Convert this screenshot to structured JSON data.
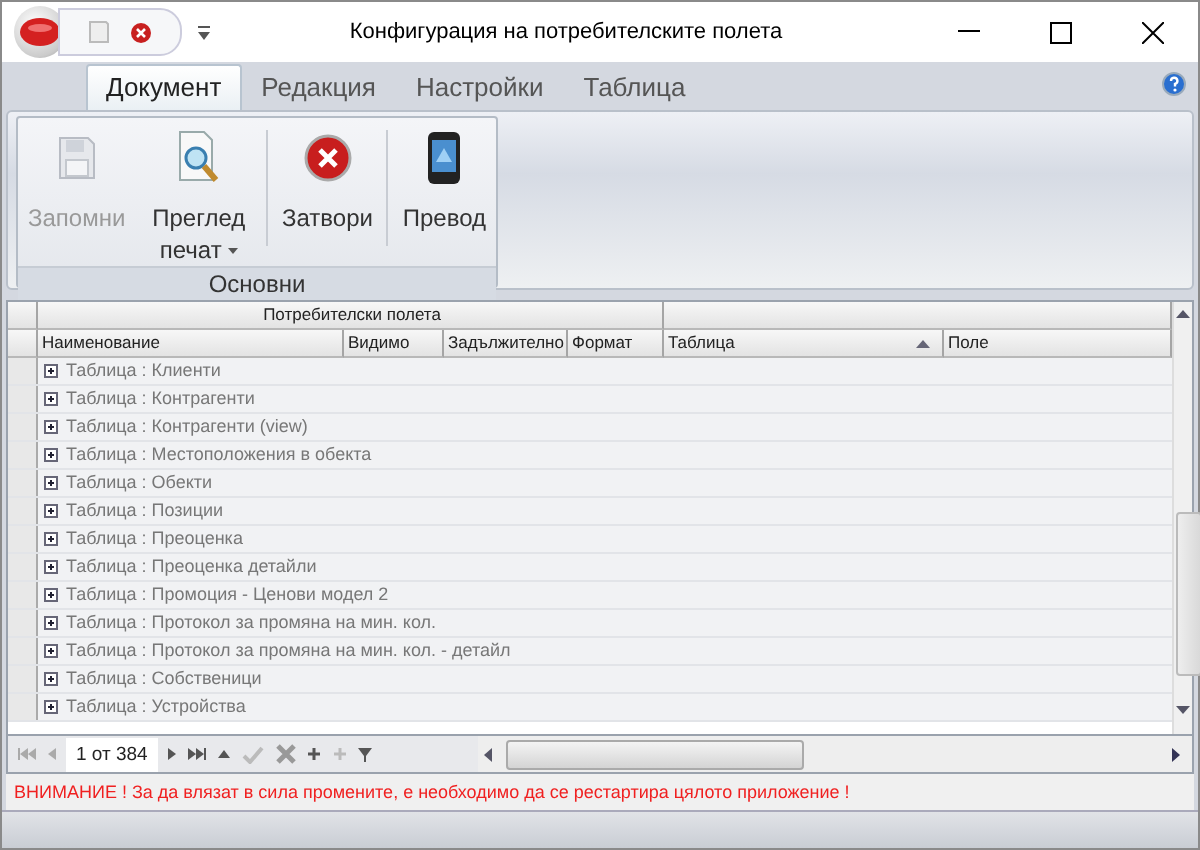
{
  "window": {
    "title": "Конфигурация на потребителските полета"
  },
  "tabs": [
    {
      "label": "Документ",
      "selected": true
    },
    {
      "label": "Редакция",
      "selected": false
    },
    {
      "label": "Настройки",
      "selected": false
    },
    {
      "label": "Таблица",
      "selected": false
    }
  ],
  "ribbon": {
    "group": "Основни",
    "buttons": [
      {
        "label": "Запомни",
        "kind": "save",
        "disabled": true,
        "dropdown": false
      },
      {
        "label": "Преглед печат",
        "kind": "preview",
        "disabled": false,
        "dropdown": true
      },
      {
        "label": "Затвори",
        "kind": "close",
        "disabled": false,
        "dropdown": false
      },
      {
        "label": "Превод",
        "kind": "translate",
        "disabled": false,
        "dropdown": false
      }
    ]
  },
  "grid": {
    "band": "Потребителски полета",
    "columns": [
      {
        "label": "Наименование",
        "sorted": false
      },
      {
        "label": "Видимо",
        "sorted": false
      },
      {
        "label": "Задължително",
        "sorted": false
      },
      {
        "label": "Формат",
        "sorted": false
      },
      {
        "label": "Таблица",
        "sorted": true
      },
      {
        "label": "Поле",
        "sorted": false
      }
    ],
    "rows": [
      {
        "label": "Таблица : Клиенти",
        "expanded": false
      },
      {
        "label": "Таблица : Контрагенти",
        "expanded": false
      },
      {
        "label": "Таблица : Контрагенти (view)",
        "expanded": false
      },
      {
        "label": "Таблица : Местоположения в обекта",
        "expanded": false
      },
      {
        "label": "Таблица : Обекти",
        "expanded": false
      },
      {
        "label": "Таблица : Позиции",
        "expanded": false
      },
      {
        "label": "Таблица : Преоценка",
        "expanded": false
      },
      {
        "label": "Таблица : Преоценка детайли",
        "expanded": false
      },
      {
        "label": "Таблица : Промоция - Ценови модел 2",
        "expanded": false
      },
      {
        "label": "Таблица : Протокол за промяна на мин. кол.",
        "expanded": false
      },
      {
        "label": "Таблица : Протокол за промяна на мин. кол. - детайл",
        "expanded": false
      },
      {
        "label": "Таблица : Собственици",
        "expanded": false
      },
      {
        "label": "Таблица : Устройства",
        "expanded": false
      }
    ],
    "navigator": {
      "position": "1 от 384"
    }
  },
  "warning": "ВНИМАНИЕ ! За да влязат в сила промените,  е необходимо да се рестартира цялото приложение !"
}
